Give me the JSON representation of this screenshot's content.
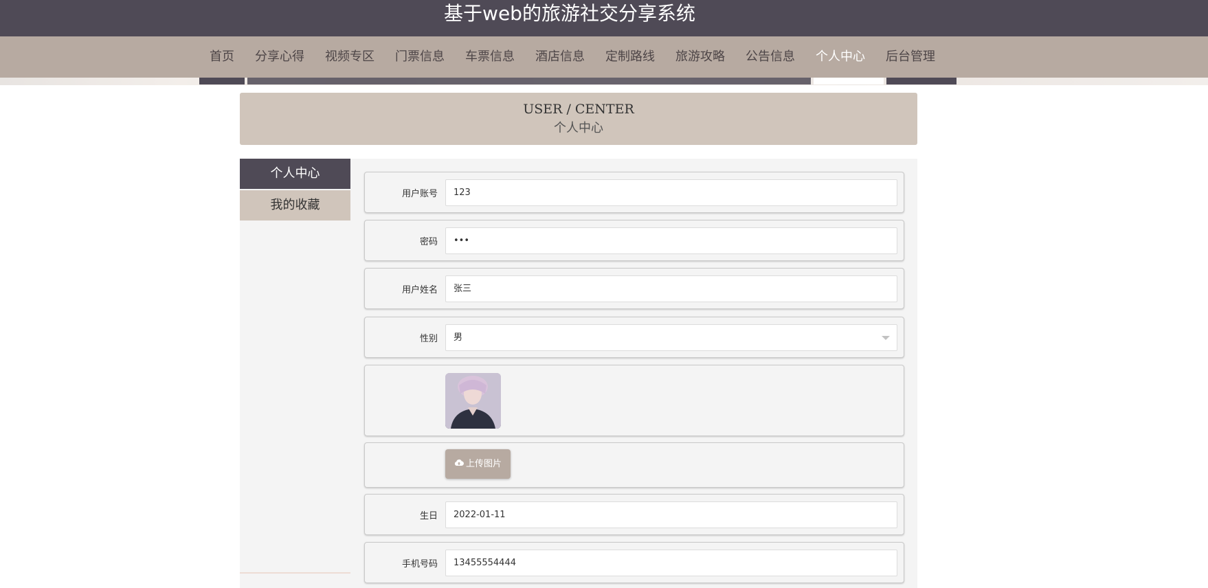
{
  "header": {
    "site_title": "基于web的旅游社交分享系统"
  },
  "nav": {
    "items": [
      {
        "label": "首页"
      },
      {
        "label": "分享心得"
      },
      {
        "label": "视频专区"
      },
      {
        "label": "门票信息"
      },
      {
        "label": "车票信息"
      },
      {
        "label": "酒店信息"
      },
      {
        "label": "定制路线"
      },
      {
        "label": "旅游攻略"
      },
      {
        "label": "公告信息"
      },
      {
        "label": "个人中心",
        "active": true
      },
      {
        "label": "后台管理"
      }
    ]
  },
  "banner": {
    "en": "USER / CENTER",
    "cn": "个人中心"
  },
  "sidebar": {
    "items": [
      {
        "label": "个人中心",
        "active": true
      },
      {
        "label": "我的收藏"
      }
    ]
  },
  "form": {
    "username": {
      "label": "用户账号",
      "value": "123"
    },
    "password": {
      "label": "密码",
      "value": "•••"
    },
    "fullname": {
      "label": "用户姓名",
      "value": "张三"
    },
    "gender": {
      "label": "性别",
      "value": "男"
    },
    "upload_label": "上传图片",
    "birthday": {
      "label": "生日",
      "value": "2022-01-11"
    },
    "phone": {
      "label": "手机号码",
      "value": "13455554444"
    }
  },
  "colors": {
    "header_bg": "#4f4a56",
    "nav_bg": "#b7aaa1",
    "banner_bg": "#d0c5bb",
    "active_text": "#ffffff"
  },
  "icons": {
    "upload": "cloud-upload-icon",
    "select": "chevron-down-icon"
  }
}
